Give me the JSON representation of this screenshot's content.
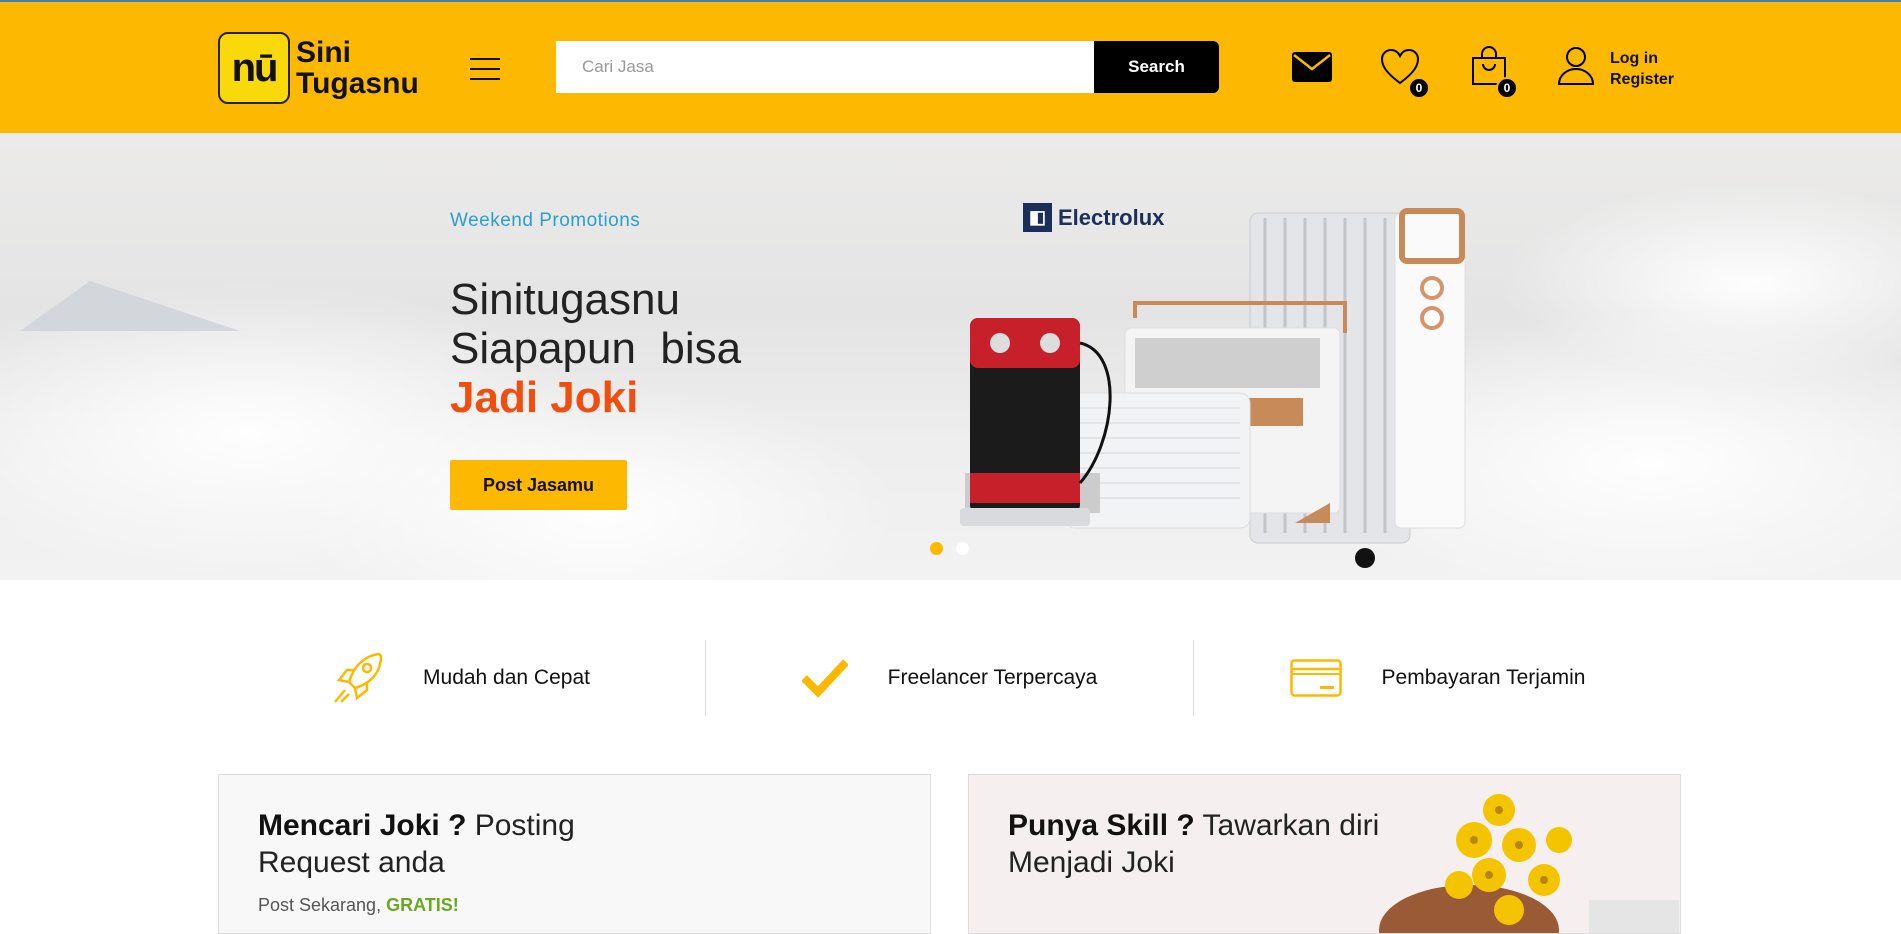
{
  "header": {
    "logo": {
      "mark": "nū",
      "line1": "Sini",
      "line2": "Tugasnu"
    },
    "search": {
      "placeholder": "Cari Jasa",
      "value": "",
      "button": "Search"
    },
    "icons": {
      "mail": "mail-icon",
      "wishlist": "heart-icon",
      "cart": "shopping-bag-icon",
      "user": "user-icon"
    },
    "wishlist_count": "0",
    "cart_count": "0",
    "login": "Log in",
    "register": "Register"
  },
  "hero": {
    "promo": "Weekend Promotions",
    "line1": "Sinitugasnu",
    "line2": "Siapapun  bisa",
    "line3": "Jadi Joki",
    "button": "Post Jasamu",
    "brand": "Electrolux",
    "slides": 2,
    "active_slide": 1
  },
  "features": [
    {
      "icon": "rocket-icon",
      "label": "Mudah dan Cepat"
    },
    {
      "icon": "checkmark-icon",
      "label": "Freelancer Terpercaya"
    },
    {
      "icon": "credit-card-icon",
      "label": "Pembayaran Terjamin"
    }
  ],
  "cards": [
    {
      "bold": "Mencari Joki ?",
      "rest1": " Posting",
      "rest2": "Request anda",
      "sub": "Post Sekarang, ",
      "sub_bold": "GRATIS!"
    },
    {
      "bold": "Punya Skill ?",
      "rest1": " Tawarkan diri",
      "rest2": "Menjadi Joki"
    }
  ],
  "colors": {
    "accent": "#FDB901",
    "headline": "#F04E0F",
    "promo": "#2A9FD6",
    "free": "#6AA822"
  }
}
